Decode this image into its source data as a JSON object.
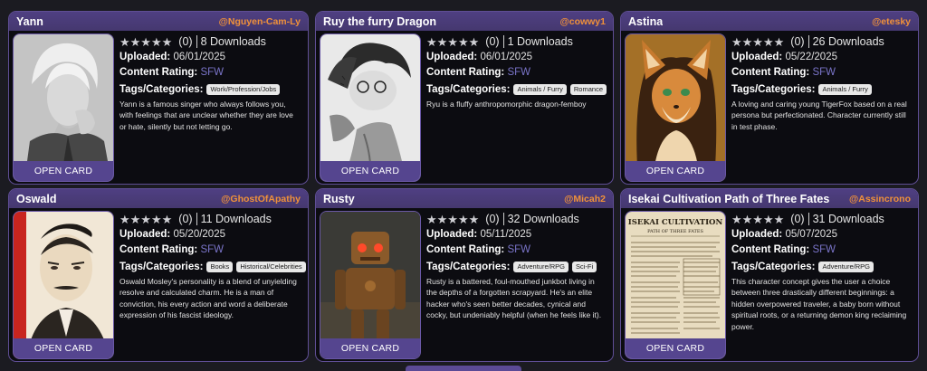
{
  "labels": {
    "uploaded": "Uploaded:",
    "rating": "Content Rating:",
    "tags": "Tags/Categories:",
    "open": "OPEN CARD",
    "stars": "★★★★★"
  },
  "cards": [
    {
      "title": "Yann",
      "author": "@Nguyen-Cam-Ly",
      "rating_count": "(0)",
      "downloads": "8 Downloads",
      "uploaded": "06/01/2025",
      "content_rating": "SFW",
      "tags": [
        "Work/Profession/Jobs"
      ],
      "description": "Yann is a famous singer who always follows you, with feelings that are unclear whether they are love or hate, silently but not letting go."
    },
    {
      "title": "Ruy the furry Dragon",
      "author": "@cowwy1",
      "rating_count": "(0)",
      "downloads": "1 Downloads",
      "uploaded": "06/01/2025",
      "content_rating": "SFW",
      "tags": [
        "Animals / Furry",
        "Romance"
      ],
      "description": "Ryu is a fluffy anthropomorphic dragon-femboy"
    },
    {
      "title": "Astina",
      "author": "@etesky",
      "rating_count": "(0)",
      "downloads": "26 Downloads",
      "uploaded": "05/22/2025",
      "content_rating": "SFW",
      "tags": [
        "Animals / Furry"
      ],
      "description": "A loving and caring young TigerFox based on a real persona but perfectionated. Character currently still in test phase."
    },
    {
      "title": "Oswald",
      "author": "@GhostOfApathy",
      "rating_count": "(0)",
      "downloads": "11 Downloads",
      "uploaded": "05/20/2025",
      "content_rating": "SFW",
      "tags": [
        "Books",
        "Historical/Celebrities"
      ],
      "description": "Oswald Mosley's personality is a blend of unyielding resolve and calculated charm. He is a man of conviction, his every action and word a deliberate expression of his fascist ideology."
    },
    {
      "title": "Rusty",
      "author": "@Micah2",
      "rating_count": "(0)",
      "downloads": "32 Downloads",
      "uploaded": "05/11/2025",
      "content_rating": "SFW",
      "tags": [
        "Adventure/RPG",
        "Sci-Fi"
      ],
      "description": "Rusty is a battered, foul-mouthed junkbot living in the depths of a forgotten scrapyard. He's an elite hacker who's seen better decades, cynical and cocky, but undeniably helpful (when he feels like it)."
    },
    {
      "title": "Isekai Cultivation Path of Three Fates",
      "author": "@Assincrono",
      "rating_count": "(0)",
      "downloads": "31 Downloads",
      "uploaded": "05/07/2025",
      "content_rating": "SFW",
      "tags": [
        "Adventure/RPG"
      ],
      "description": "This character concept gives the user a choice between three drastically different beginnings: a hidden overpowered traveler, a baby born without spiritual roots, or a returning demon king reclaiming power.",
      "thumb_title": "ISEKAI CULTIVATION",
      "thumb_subtitle": "PATH OF THREE FATES"
    }
  ]
}
